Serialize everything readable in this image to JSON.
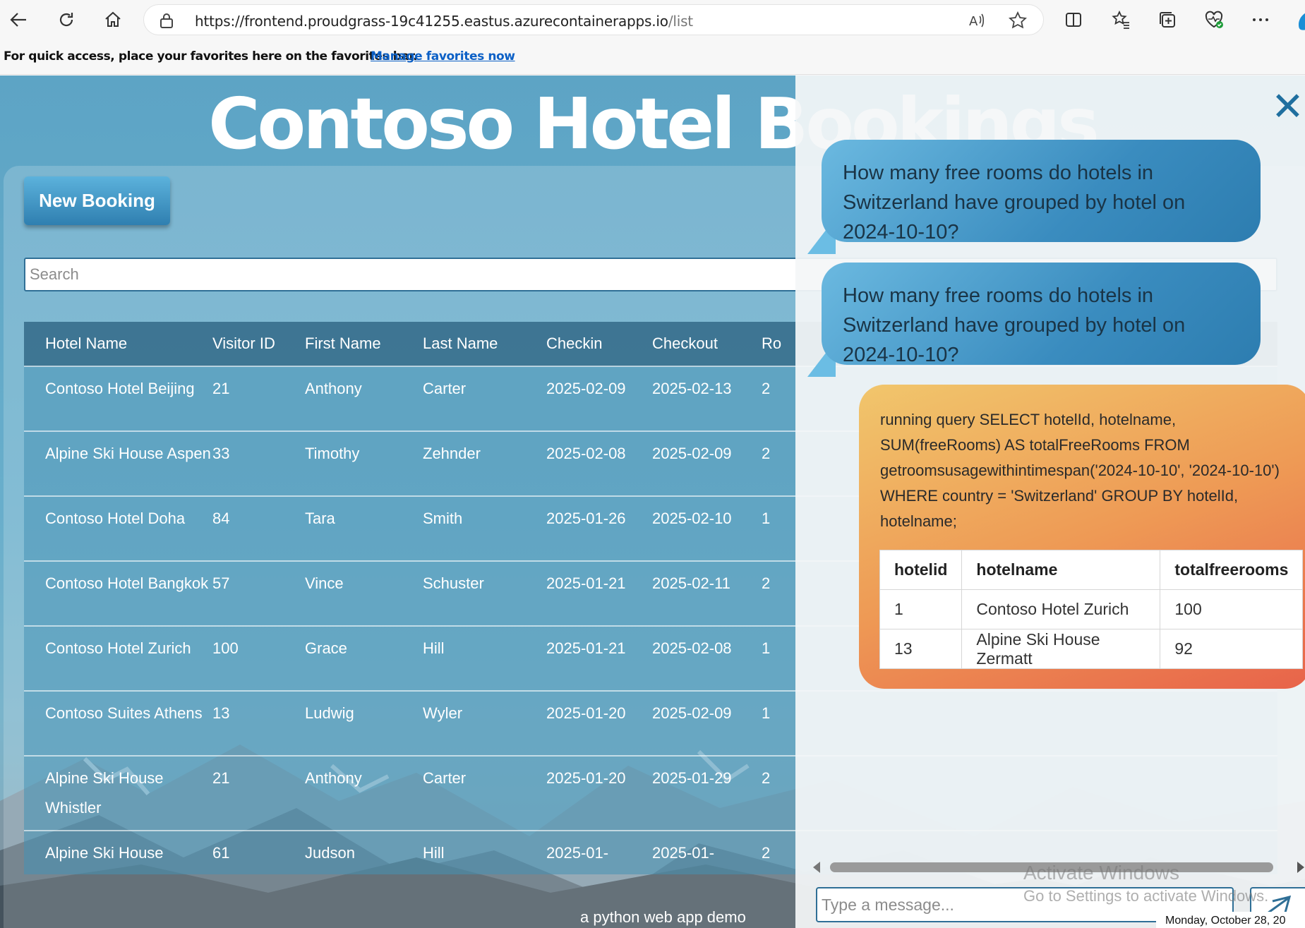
{
  "browser": {
    "url_host": "https://frontend.proudgrass-19c41255.eastus.azurecontainerapps.io",
    "url_path": "/list",
    "favorites_message": "For quick access, place your favorites here on the favorites bar.",
    "favorites_link": "Manage favorites now"
  },
  "page": {
    "title": "Contoso Hotel Bookings",
    "new_booking_label": "New Booking",
    "search_placeholder": "Search",
    "footer": "a python web app demo"
  },
  "table": {
    "headers": [
      "Hotel Name",
      "Visitor ID",
      "First Name",
      "Last Name",
      "Checkin",
      "Checkout",
      "Ro"
    ],
    "rows": [
      [
        "Contoso Hotel Beijing",
        "21",
        "Anthony",
        "Carter",
        "2025-02-09",
        "2025-02-13",
        "2"
      ],
      [
        "Alpine Ski House Aspen",
        "33",
        "Timothy",
        "Zehnder",
        "2025-02-08",
        "2025-02-09",
        "2"
      ],
      [
        "Contoso Hotel Doha",
        "84",
        "Tara",
        "Smith",
        "2025-01-26",
        "2025-02-10",
        "1"
      ],
      [
        "Contoso Hotel Bangkok",
        "57",
        "Vince",
        "Schuster",
        "2025-01-21",
        "2025-02-11",
        "2"
      ],
      [
        "Contoso Hotel Zurich",
        "100",
        "Grace",
        "Hill",
        "2025-01-21",
        "2025-02-08",
        "1"
      ],
      [
        "Contoso Suites Athens",
        "13",
        "Ludwig",
        "Wyler",
        "2025-01-20",
        "2025-02-09",
        "1"
      ],
      [
        "Alpine Ski House Whistler",
        "21",
        "Anthony",
        "Carter",
        "2025-01-20",
        "2025-01-29",
        "2"
      ],
      [
        "Alpine Ski House",
        "61",
        "Judson",
        "Hill",
        "2025-01-",
        "2025-01-",
        "2"
      ]
    ]
  },
  "chat": {
    "user_messages": [
      "How many free rooms do hotels in Switzerland have grouped by hotel on 2024-10-10?",
      "How many free rooms do hotels in Switzerland have grouped by hotel on 2024-10-10?"
    ],
    "bot_text": "running query SELECT hotelId, hotelname, SUM(freeRooms) AS totalFreeRooms FROM getroomsusagewithintimespan('2024-10-10', '2024-10-10') WHERE country = 'Switzerland' GROUP BY hotelId, hotelname;",
    "result_headers": [
      "hotelid",
      "hotelname",
      "totalfreerooms"
    ],
    "result_rows": [
      [
        "1",
        "Contoso Hotel Zurich",
        "100"
      ],
      [
        "13",
        "Alpine Ski House Zermatt",
        "92"
      ]
    ],
    "input_placeholder": "Type a message...",
    "close_symbol": "✕"
  },
  "os": {
    "watermark_title": "Activate Windows",
    "watermark_sub": "Go to Settings to activate Windows.",
    "clock": "Monday, October 28, 20"
  },
  "colors": {
    "accent": "#2f6f96",
    "user_bubble": "#3a8cbf",
    "bot_bubble_start": "#f1c66c",
    "bot_bubble_end": "#e8634a"
  }
}
